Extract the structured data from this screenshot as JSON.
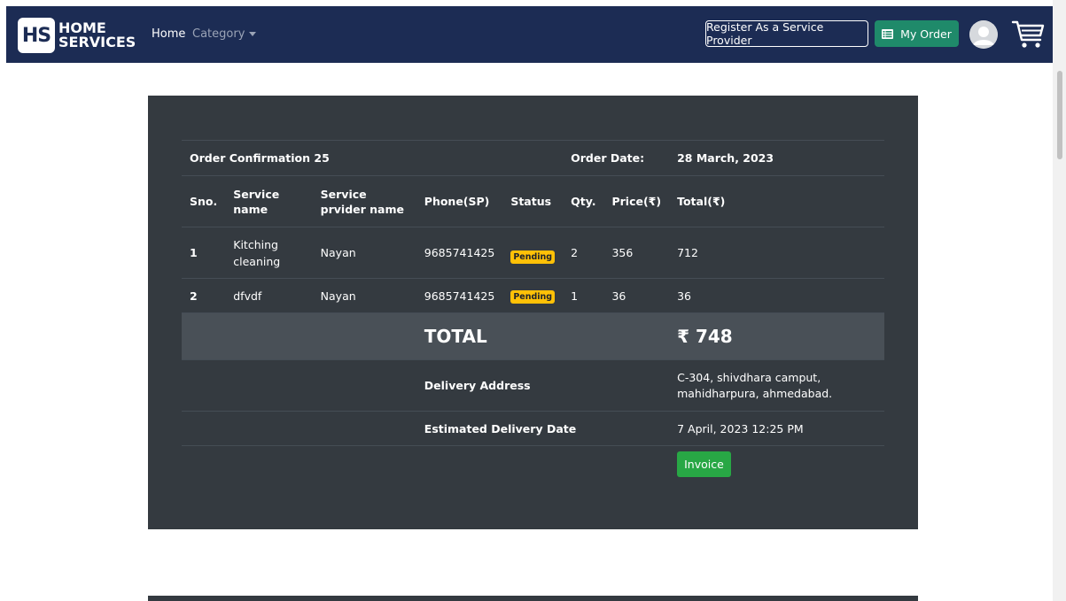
{
  "nav": {
    "logo_mark": "HS",
    "logo_line1": "HOME",
    "logo_line2": "SERVICES",
    "home": "Home",
    "category": "Category",
    "register_button": "Register As a Service Provider",
    "my_order_button": "My Order"
  },
  "order": {
    "confirmation_label": "Order Confirmation 25",
    "order_date_label": "Order Date:",
    "order_date": "28 March, 2023",
    "columns": [
      "Sno.",
      "Service name",
      "Service prvider name",
      "Phone(SP)",
      "Status",
      "Qty.",
      "Price(₹)",
      "Total(₹)"
    ],
    "items": [
      {
        "sno": "1",
        "service": "Kitching cleaning",
        "provider": "Nayan",
        "phone": "9685741425",
        "status": "Pending",
        "qty": "2",
        "price": "356",
        "total": "712"
      },
      {
        "sno": "2",
        "service": "dfvdf",
        "provider": "Nayan",
        "phone": "9685741425",
        "status": "Pending",
        "qty": "1",
        "price": "36",
        "total": "36"
      }
    ],
    "total_label": "TOTAL",
    "total_value": "₹ 748",
    "delivery_address_label": "Delivery Address",
    "delivery_address": "C-304, shivdhara camput, mahidharpura, ahmedabad.",
    "estimated_label": "Estimated Delivery Date",
    "estimated_value": "7 April, 2023 12:25 PM",
    "invoice_button": "Invoice"
  },
  "colors": {
    "navbar": "#1c2c54",
    "card": "#343a40",
    "total_row": "#495057",
    "badge": "#ffc107",
    "invoice": "#28a745",
    "my_order": "#1f8a6a"
  },
  "icons": [
    "order-list-icon",
    "user-avatar-icon",
    "cart-icon",
    "chevron-down-icon"
  ]
}
